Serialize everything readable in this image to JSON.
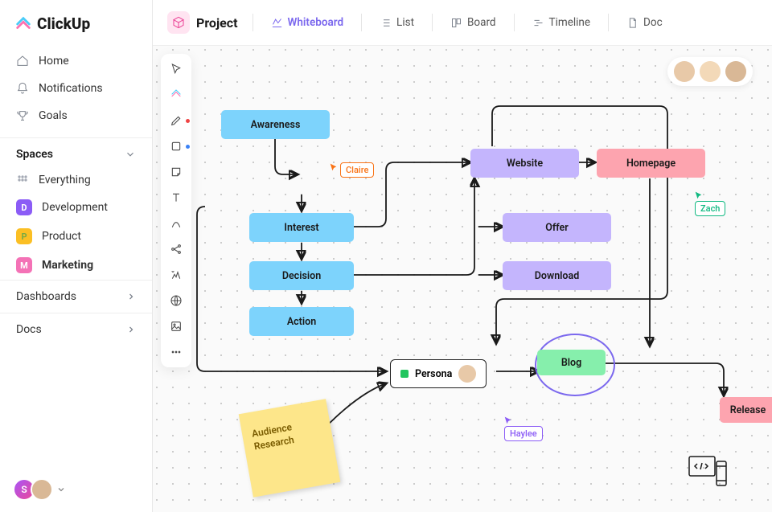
{
  "app": {
    "name": "ClickUp"
  },
  "nav": {
    "home": "Home",
    "notifications": "Notifications",
    "goals": "Goals"
  },
  "spaces": {
    "header": "Spaces",
    "everything": "Everything",
    "items": [
      {
        "letter": "D",
        "label": "Development"
      },
      {
        "letter": "P",
        "label": "Product"
      },
      {
        "letter": "M",
        "label": "Marketing"
      }
    ]
  },
  "sections": {
    "dashboards": "Dashboards",
    "docs": "Docs"
  },
  "topbar": {
    "project": "Project",
    "tabs": {
      "whiteboard": "Whiteboard",
      "list": "List",
      "board": "Board",
      "timeline": "Timeline",
      "doc": "Doc"
    }
  },
  "whiteboard": {
    "nodes": {
      "awareness": "Awareness",
      "interest": "Interest",
      "decision": "Decision",
      "action": "Action",
      "website": "Website",
      "offer": "Offer",
      "download": "Download",
      "homepage": "Homepage",
      "blog": "Blog",
      "release": "Release",
      "persona": "Persona"
    },
    "sticky": "Audience Research",
    "cursors": {
      "claire": "Claire",
      "zach": "Zach",
      "haylee": "Haylee"
    }
  },
  "presence": {
    "dot_colors": [
      "#10b981",
      "#3b82f6",
      "#f59e0b"
    ]
  },
  "bottom_user": "S"
}
